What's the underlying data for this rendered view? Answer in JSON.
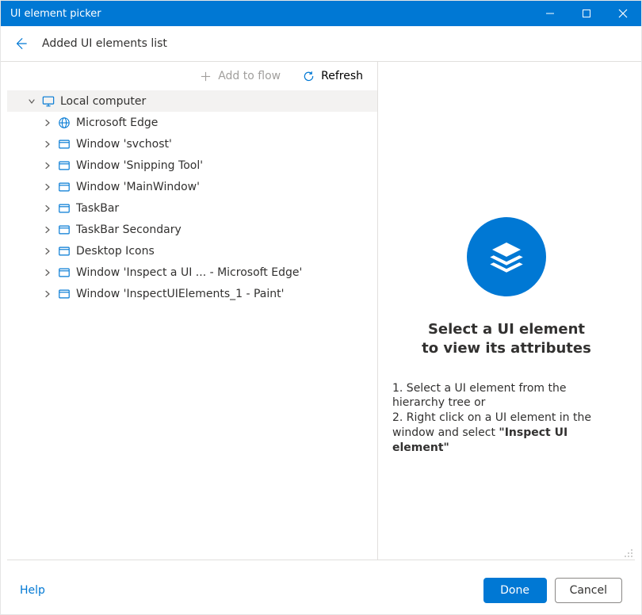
{
  "window": {
    "title": "UI element picker"
  },
  "header": {
    "title": "Added UI elements list"
  },
  "toolbar": {
    "add_to_flow": "Add to flow",
    "refresh": "Refresh"
  },
  "tree": {
    "root": {
      "label": "Local computer",
      "icon": "monitor-icon"
    },
    "children": [
      {
        "label": "Microsoft Edge",
        "icon": "globe-icon"
      },
      {
        "label": "Window 'svchost'",
        "icon": "window-icon"
      },
      {
        "label": "Window 'Snipping Tool'",
        "icon": "window-icon"
      },
      {
        "label": "Window 'MainWindow'",
        "icon": "window-icon"
      },
      {
        "label": "TaskBar",
        "icon": "window-icon"
      },
      {
        "label": "TaskBar Secondary",
        "icon": "window-icon"
      },
      {
        "label": "Desktop Icons",
        "icon": "window-icon"
      },
      {
        "label": "Window 'Inspect a UI  ...  - Microsoft Edge'",
        "icon": "window-icon"
      },
      {
        "label": "Window 'InspectUIElements_1 - Paint'",
        "icon": "window-icon"
      }
    ]
  },
  "placeholder": {
    "title_line1": "Select a UI element",
    "title_line2": "to view its attributes",
    "step1": "1. Select a UI element from the hierarchy tree or",
    "step2_prefix": "2. Right click on a UI element in the window and select ",
    "step2_bold": "\"Inspect UI element\""
  },
  "footer": {
    "help": "Help",
    "done": "Done",
    "cancel": "Cancel"
  },
  "colors": {
    "accent": "#0078d4"
  }
}
